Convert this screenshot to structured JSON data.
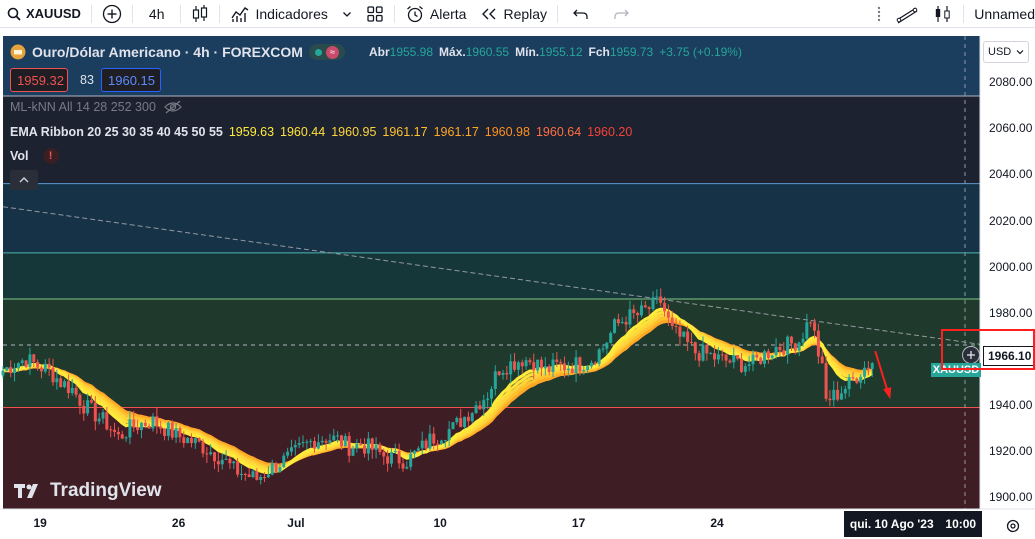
{
  "toolbar": {
    "symbol": "XAUUSD",
    "interval": "4h",
    "indicators_label": "Indicadores",
    "alert_label": "Alerta",
    "replay_label": "Replay",
    "layout_name": "Unnamed"
  },
  "legend": {
    "title": "Ouro/Dólar Americano · 4h · FOREXCOM",
    "open_label": "Abr",
    "open": "1955.98",
    "high_label": "Máx.",
    "high": "1960.55",
    "low_label": "Mín.",
    "low": "1955.12",
    "close_label": "Fch",
    "close": "1959.73",
    "change": "+3.75 (+0.19%)",
    "bid": "1959.32",
    "spread": "83",
    "ask": "1960.15",
    "knn_label": "ML-kNN All 14 28 252 300",
    "ema_name": "EMA Ribbon 20 25 30 35 40 45 50 55",
    "ema_values": [
      "1959.63",
      "1960.44",
      "1960.95",
      "1961.17",
      "1961.17",
      "1960.98",
      "1960.64",
      "1960.20"
    ],
    "ema_value_colors": [
      "#ffeb3b",
      "#ffe03b",
      "#ffd43b",
      "#ffc12e",
      "#ffa726",
      "#ff9020",
      "#ff7043",
      "#f44336"
    ],
    "vol_label": "Vol"
  },
  "currency": "USD",
  "watermark": "TradingView",
  "price_badge": "1966.10",
  "symbol_tag": "XAUUSD",
  "time_axis": {
    "labels": [
      "19",
      "26",
      "Jul",
      "10",
      "17",
      "24",
      "Ago"
    ],
    "cursor_date": "qui. 10 Ago '23",
    "cursor_time": "10:00"
  },
  "chart_data": {
    "type": "candlestick",
    "ylim": [
      1895,
      2100
    ],
    "y_ticks": [
      2080,
      2060,
      2040,
      2020,
      2000,
      1980,
      1960,
      1940,
      1920,
      1900
    ],
    "y_tick_labels": [
      "2080.00",
      "2060.00",
      "2040.00",
      "2020.00",
      "2000.00",
      "1980.00",
      "1960.00",
      "1940.00",
      "1920.00",
      "1900.00"
    ],
    "x_ticks": [
      {
        "label": "19",
        "x": 10
      },
      {
        "label": "26",
        "x": 46
      },
      {
        "label": "Jul",
        "x": 76
      },
      {
        "label": "10",
        "x": 114
      },
      {
        "label": "17",
        "x": 150
      },
      {
        "label": "24",
        "x": 186
      },
      {
        "label": "Ago",
        "x": 222
      }
    ],
    "close_path": [
      [
        0,
        1955
      ],
      [
        3,
        1958
      ],
      [
        6,
        1960
      ],
      [
        9,
        1957
      ],
      [
        12,
        1955
      ],
      [
        15,
        1950
      ],
      [
        18,
        1947
      ],
      [
        21,
        1940
      ],
      [
        24,
        1936
      ],
      [
        27,
        1932
      ],
      [
        30,
        1926
      ],
      [
        33,
        1930
      ],
      [
        36,
        1932
      ],
      [
        39,
        1933
      ],
      [
        42,
        1930
      ],
      [
        45,
        1927
      ],
      [
        48,
        1925
      ],
      [
        51,
        1923
      ],
      [
        54,
        1920
      ],
      [
        57,
        1917
      ],
      [
        60,
        1912
      ],
      [
        63,
        1910
      ],
      [
        66,
        1908
      ],
      [
        69,
        1912
      ],
      [
        72,
        1915
      ],
      [
        75,
        1918
      ],
      [
        78,
        1922
      ],
      [
        81,
        1925
      ],
      [
        84,
        1926
      ],
      [
        87,
        1925
      ],
      [
        90,
        1922
      ],
      [
        93,
        1923
      ],
      [
        96,
        1921
      ],
      [
        99,
        1918
      ],
      [
        102,
        1917
      ],
      [
        105,
        1916
      ],
      [
        108,
        1920
      ],
      [
        111,
        1925
      ],
      [
        114,
        1928
      ],
      [
        117,
        1930
      ],
      [
        120,
        1935
      ],
      [
        123,
        1940
      ],
      [
        126,
        1945
      ],
      [
        129,
        1956
      ],
      [
        132,
        1958
      ],
      [
        135,
        1960
      ],
      [
        138,
        1959
      ],
      [
        141,
        1955
      ],
      [
        144,
        1957
      ],
      [
        147,
        1957
      ],
      [
        150,
        1958
      ],
      [
        153,
        1960
      ],
      [
        156,
        1965
      ],
      [
        159,
        1974
      ],
      [
        162,
        1978
      ],
      [
        165,
        1979
      ],
      [
        168,
        1982
      ],
      [
        171,
        1985
      ],
      [
        174,
        1972
      ],
      [
        177,
        1968
      ],
      [
        180,
        1963
      ],
      [
        183,
        1962
      ],
      [
        186,
        1960
      ],
      [
        189,
        1959
      ],
      [
        192,
        1958
      ],
      [
        195,
        1958
      ],
      [
        198,
        1962
      ],
      [
        201,
        1965
      ],
      [
        204,
        1966
      ],
      [
        207,
        1968
      ],
      [
        210,
        1978
      ],
      [
        213,
        1955
      ],
      [
        214,
        1942
      ],
      [
        217,
        1945
      ],
      [
        220,
        1949
      ],
      [
        223,
        1955
      ],
      [
        226,
        1959
      ]
    ],
    "ema_periods": [
      20,
      25,
      30,
      35,
      40,
      45,
      50,
      55
    ],
    "ema_colors": [
      "#ffeb3b",
      "#ffe03b",
      "#ffd43b",
      "#ffc12e",
      "#ffa726",
      "#ff9020",
      "#ff7043",
      "#f44336"
    ],
    "up_color": "#26a69a",
    "down_color": "#ef5350",
    "horizontal_levels": [
      {
        "price": 2074,
        "color": "#b2b5be"
      },
      {
        "price": 2036,
        "color": "#5d9ad3"
      },
      {
        "price": 2006,
        "color": "#4db6ac"
      },
      {
        "price": 1986,
        "color": "#81c784"
      },
      {
        "price": 1939,
        "color": "#ef5350"
      }
    ],
    "zones": [
      {
        "from": 2036,
        "to": 2074,
        "color": "#1c2230"
      },
      {
        "from": 2006,
        "to": 2036,
        "color": "#163247"
      },
      {
        "from": 1986,
        "to": 2006,
        "color": "#16373a"
      },
      {
        "from": 1939,
        "to": 1986,
        "color": "#1f3a2c"
      },
      {
        "from": 1895,
        "to": 1939,
        "color": "#3e1d24"
      }
    ],
    "trendline": [
      [
        0,
        2026
      ],
      [
        260,
        1965
      ]
    ],
    "x_range": [
      0,
      260
    ]
  }
}
